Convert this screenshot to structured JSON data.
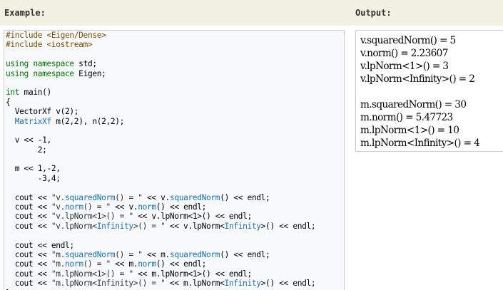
{
  "headings": {
    "example": "Example:",
    "output": "Output:"
  },
  "code_lines": [
    [
      [
        "pp",
        "#include <Eigen/Dense>"
      ]
    ],
    [
      [
        "pp",
        "#include <iostream>"
      ]
    ],
    [],
    [
      [
        "kw",
        "using namespace"
      ],
      [
        "pl",
        " std;"
      ]
    ],
    [
      [
        "kw",
        "using namespace"
      ],
      [
        "pl",
        " Eigen;"
      ]
    ],
    [],
    [
      [
        "kw",
        "int"
      ],
      [
        "pl",
        " main()"
      ]
    ],
    [
      [
        "pl",
        "{"
      ]
    ],
    [
      [
        "pl",
        "  VectorXf v(2);"
      ]
    ],
    [
      [
        "pl",
        "  "
      ],
      [
        "ty",
        "MatrixXf"
      ],
      [
        "pl",
        " m(2,2), n(2,2);"
      ]
    ],
    [],
    [
      [
        "pl",
        "  v << -1,"
      ]
    ],
    [
      [
        "pl",
        "       2;"
      ]
    ],
    [],
    [
      [
        "pl",
        "  m << 1,-2,"
      ]
    ],
    [
      [
        "pl",
        "       -3,4;"
      ]
    ],
    [],
    [
      [
        "pl",
        "  cout << "
      ],
      [
        "str",
        "\"v."
      ],
      [
        "ty",
        "squaredNorm"
      ],
      [
        "str",
        "() = \""
      ],
      [
        "pl",
        " << v."
      ],
      [
        "ty",
        "squaredNorm"
      ],
      [
        "pl",
        "() << endl;"
      ]
    ],
    [
      [
        "pl",
        "  cout << "
      ],
      [
        "str",
        "\"v."
      ],
      [
        "ty",
        "norm"
      ],
      [
        "str",
        "() = \""
      ],
      [
        "pl",
        " << v."
      ],
      [
        "ty",
        "norm"
      ],
      [
        "pl",
        "() << endl;"
      ]
    ],
    [
      [
        "pl",
        "  cout << "
      ],
      [
        "str",
        "\"v.lpNorm<1>() = \""
      ],
      [
        "pl",
        " << v.lpNorm<1>() << endl;"
      ]
    ],
    [
      [
        "pl",
        "  cout << "
      ],
      [
        "str",
        "\"v.lpNorm<"
      ],
      [
        "ty",
        "Infinity"
      ],
      [
        "str",
        ">() = \""
      ],
      [
        "pl",
        " << v.lpNorm<"
      ],
      [
        "ty",
        "Infinity"
      ],
      [
        "pl",
        ">() << endl;"
      ]
    ],
    [],
    [
      [
        "pl",
        "  cout << endl;"
      ]
    ],
    [
      [
        "pl",
        "  cout << "
      ],
      [
        "str",
        "\"m."
      ],
      [
        "ty",
        "squaredNorm"
      ],
      [
        "str",
        "() = \""
      ],
      [
        "pl",
        " << m."
      ],
      [
        "ty",
        "squaredNorm"
      ],
      [
        "pl",
        "() << endl;"
      ]
    ],
    [
      [
        "pl",
        "  cout << "
      ],
      [
        "str",
        "\"m."
      ],
      [
        "ty",
        "norm"
      ],
      [
        "str",
        "() = \""
      ],
      [
        "pl",
        " << m."
      ],
      [
        "ty",
        "norm"
      ],
      [
        "pl",
        "() << endl;"
      ]
    ],
    [
      [
        "pl",
        "  cout << "
      ],
      [
        "str",
        "\"m.lpNorm<1>() = \""
      ],
      [
        "pl",
        " << m.lpNorm<1>() << endl;"
      ]
    ],
    [
      [
        "pl",
        "  cout << "
      ],
      [
        "str",
        "\"m.lpNorm<Infinity>() = \""
      ],
      [
        "pl",
        " << m.lpNorm<"
      ],
      [
        "ty",
        "Infinity"
      ],
      [
        "pl",
        ">() << endl;"
      ]
    ],
    [
      [
        "pl",
        "}"
      ]
    ]
  ],
  "output_lines": [
    "v.squaredNorm() = 5",
    "v.norm() = 2.23607",
    "v.lpNorm<1>() = 3",
    "v.lpNorm<Infinity>() = 2",
    "",
    "m.squaredNorm() = 30",
    "m.norm() = 5.47723",
    "m.lpNorm<1>() = 10",
    "m.lpNorm<Infinity>() = 4"
  ]
}
